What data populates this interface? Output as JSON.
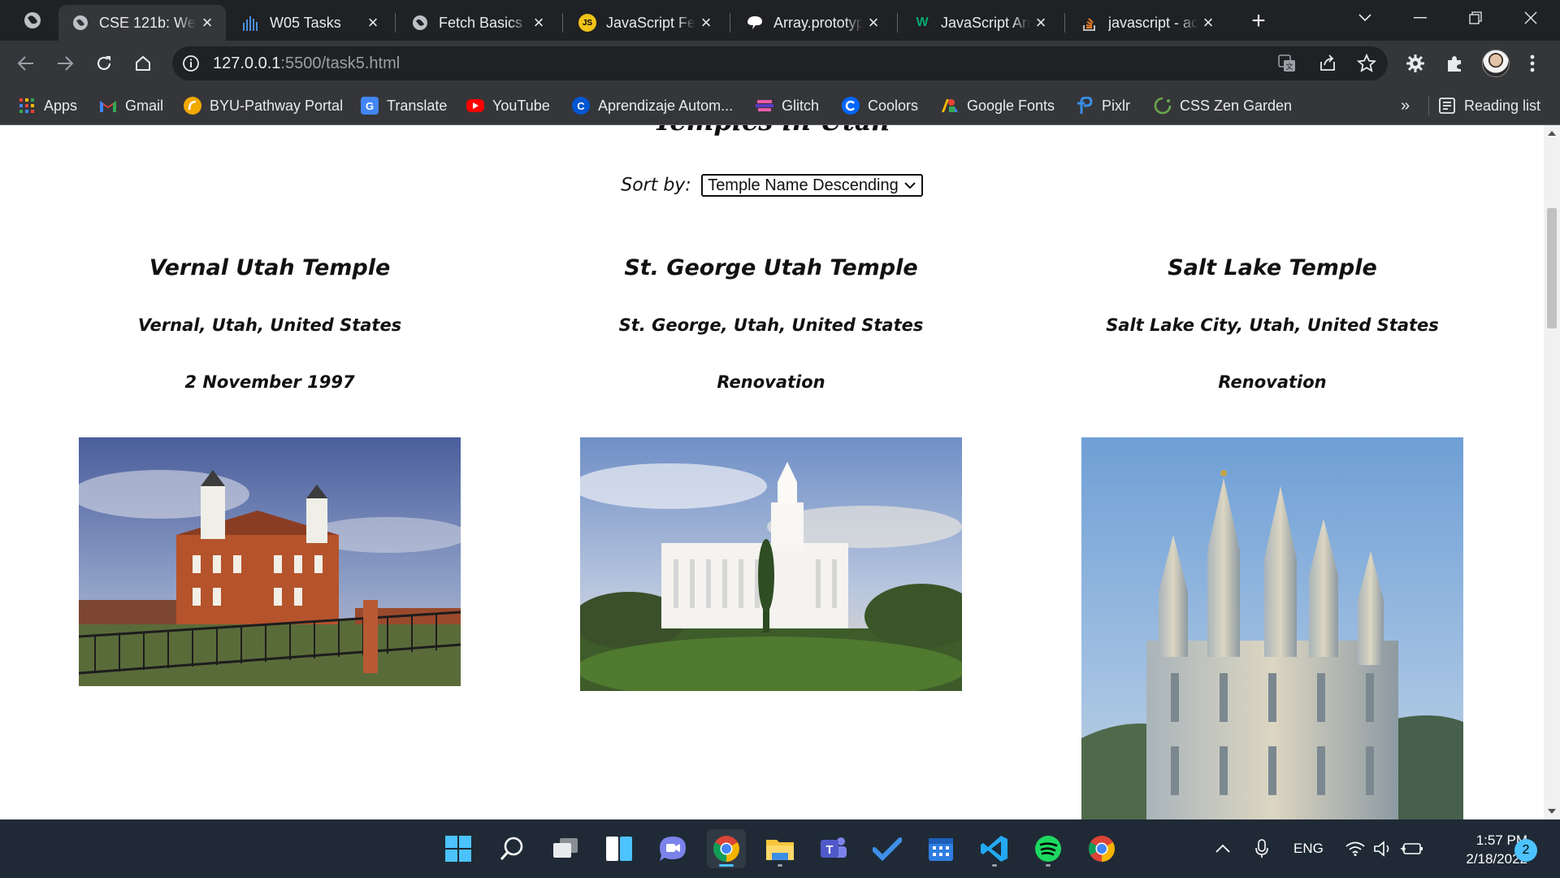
{
  "browser": {
    "tabs": [
      {
        "title": "CSE 121b: We",
        "icon": "globe-icon",
        "active": true
      },
      {
        "title": "W05 Tasks",
        "icon": "chart-bars-icon",
        "active": false
      },
      {
        "title": "Fetch Basics -",
        "icon": "globe-icon",
        "active": false
      },
      {
        "title": "JavaScript Fet",
        "icon": "js-icon",
        "active": false
      },
      {
        "title": "Array.prototyp",
        "icon": "brain-icon",
        "active": false
      },
      {
        "title": "JavaScript Arr",
        "icon": "w3-icon",
        "active": false
      },
      {
        "title": "javascript - ac",
        "icon": "stackoverflow-icon",
        "active": false
      }
    ],
    "address": {
      "host": "127.0.0.1",
      "path": ":5500/task5.html"
    },
    "bookmarks": [
      {
        "label": "Apps",
        "icon": "apps-grid-icon",
        "color": "#e8453c"
      },
      {
        "label": "Gmail",
        "icon": "gmail-icon",
        "color": "#ea4335"
      },
      {
        "label": "BYU-Pathway Portal",
        "icon": "pathway-icon",
        "color": "#f2a900"
      },
      {
        "label": "Translate",
        "icon": "translate-icon",
        "color": "#4285f4"
      },
      {
        "label": "YouTube",
        "icon": "youtube-icon",
        "color": "#ff0000"
      },
      {
        "label": "Aprendizaje Autom...",
        "icon": "coursera-icon",
        "color": "#0056d2"
      },
      {
        "label": "Glitch",
        "icon": "glitch-icon",
        "color": "#e95caa"
      },
      {
        "label": "Coolors",
        "icon": "coolors-icon",
        "color": "#0066ff"
      },
      {
        "label": "Google Fonts",
        "icon": "google-fonts-icon",
        "color": "#34a853"
      },
      {
        "label": "Pixlr",
        "icon": "pixlr-icon",
        "color": "#3a8ee6"
      },
      {
        "label": "CSS Zen Garden",
        "icon": "zen-garden-icon",
        "color": "#6aa84f"
      }
    ],
    "bookmarks_overflow": "»",
    "reading_list": "Reading list"
  },
  "page": {
    "title": "Temples in Utah",
    "sort_label": "Sort by:",
    "sort_selected": "Temple Name Descending",
    "temples": [
      {
        "name": "Vernal Utah Temple",
        "location": "Vernal, Utah, United States",
        "dedicated": "2 November 1997"
      },
      {
        "name": "St. George Utah Temple",
        "location": "St. George, Utah, United States",
        "dedicated": "Renovation"
      },
      {
        "name": "Salt Lake Temple",
        "location": "Salt Lake City, Utah, United States",
        "dedicated": "Renovation"
      }
    ]
  },
  "taskbar": {
    "apps": [
      "windows-start-icon",
      "search-icon",
      "task-view-icon",
      "widgets-icon",
      "chat-icon",
      "chrome-icon",
      "file-explorer-icon",
      "teams-icon",
      "todo-icon",
      "calendar-icon",
      "vscode-icon",
      "spotify-icon",
      "chrome-alt-icon"
    ],
    "language": "ENG",
    "time": "1:57 PM",
    "date": "2/18/2022",
    "notifications": "2"
  }
}
